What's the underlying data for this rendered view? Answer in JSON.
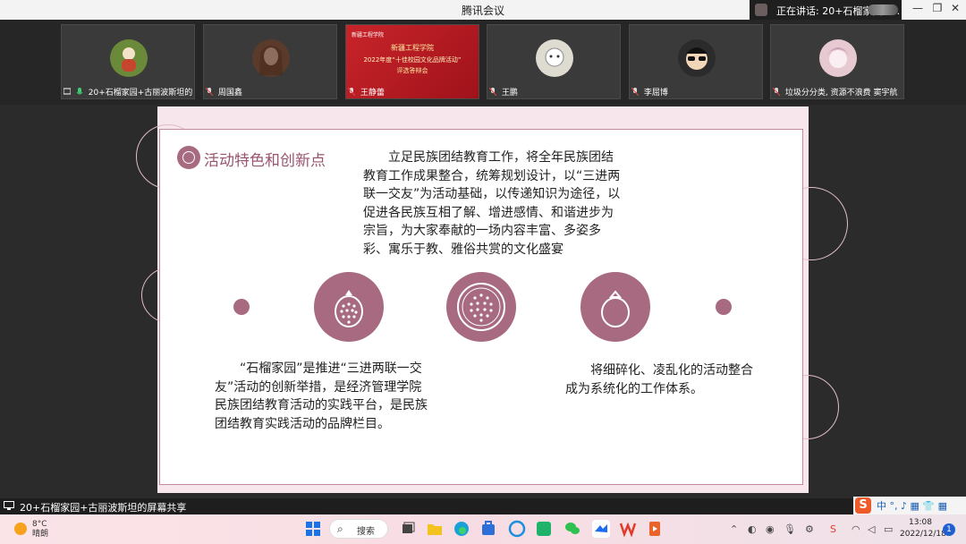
{
  "window": {
    "title": "腾讯会议",
    "speaking_label": "正在讲话: 20+石榴家园+...",
    "minimize": "—",
    "restore": "❐",
    "close": "✕"
  },
  "participants": [
    {
      "name": "20+石榴家园+古丽波斯坦的屏幕...",
      "avatar_color": "#6a8a3a"
    },
    {
      "name": "周国鑫",
      "avatar_color": "#5a3a2a"
    },
    {
      "name": "王静蕾",
      "avatar_color": "#c8242a"
    },
    {
      "name": "王鹏",
      "avatar_color": "#dedbd0"
    },
    {
      "name": "李屈博",
      "avatar_color": "#2b2b2b"
    },
    {
      "name": "垃圾分分类, 资源不浪费 窦宇航",
      "avatar_color": "#e7c9d2"
    }
  ],
  "screen_thumb": {
    "logo": "新疆工程学院",
    "line1": "新疆工程学院",
    "line2": "2022年度“十佳校园文化品牌活动”",
    "line3": "评选答辩会"
  },
  "slide": {
    "heading": "活动特色和创新点",
    "intro": "　　立足民族团结教育工作，将全年民族团结教育工作成果整合，统筹规划设计，以“三进两联一交友”为活动基础，以传递知识为途径，以促进各民族互相了解、增进感情、和谐进步为宗旨，为大家奉献的一场内容丰富、多姿多彩、寓乐于教、雅俗共赏的文化盛宴",
    "left_text": "　　“石榴家园”是推进“三进两联一交友”活动的创新举措，是经济管理学院民族团结教育活动的实践平台，是民族团结教育实践活动的品牌栏目。",
    "right_text": "　　将细碎化、凌乱化的活动整合成为系统化的工作体系。",
    "accent_color": "#a76a80"
  },
  "share_bar": {
    "label": "20+石榴家园+古丽波斯坦的屏幕共享"
  },
  "ime": {
    "logo": "S",
    "mode": "中 °, ♪ ▦ 👕 ▦"
  },
  "taskbar": {
    "weather_temp": "8°C",
    "weather_desc": "晴朗",
    "search_label": "搜索",
    "time": "13:08",
    "date": "2022/12/18",
    "notification_count": "1"
  }
}
